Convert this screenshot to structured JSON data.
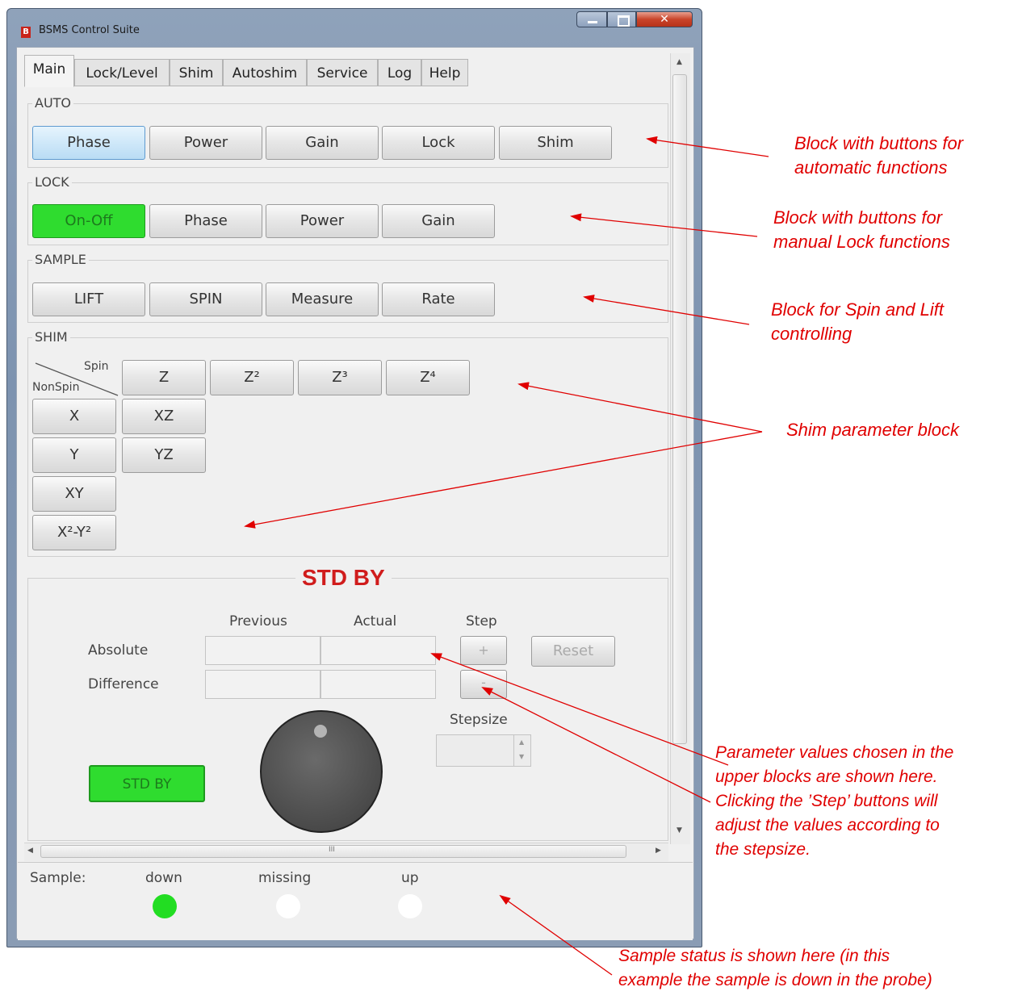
{
  "window": {
    "title": "BSMS Control Suite",
    "icon_letter": "B"
  },
  "tabs": [
    "Main",
    "Lock/Level",
    "Shim",
    "Autoshim",
    "Service",
    "Log",
    "Help"
  ],
  "auto": {
    "label": "AUTO",
    "buttons": [
      "Phase",
      "Power",
      "Gain",
      "Lock",
      "Shim"
    ]
  },
  "lock": {
    "label": "LOCK",
    "buttons": [
      "On-Off",
      "Phase",
      "Power",
      "Gain"
    ]
  },
  "sample_group": {
    "label": "SAMPLE",
    "buttons": [
      "LIFT",
      "SPIN",
      "Measure",
      "Rate"
    ]
  },
  "shim": {
    "label": "SHIM",
    "spin_label": "Spin",
    "nonspin_label": "NonSpin",
    "spin_buttons": [
      "Z",
      "Z²",
      "Z³",
      "Z⁴"
    ],
    "nonspin_buttons": [
      "X",
      "XZ",
      "Y",
      "YZ",
      "XY",
      "X²-Y²"
    ]
  },
  "control": {
    "status": "STD BY",
    "col_previous": "Previous",
    "col_actual": "Actual",
    "col_step": "Step",
    "row_absolute": "Absolute",
    "row_difference": "Difference",
    "plus": "+",
    "minus": "-",
    "reset": "Reset",
    "stepsize": "Stepsize",
    "stdby_button": "STD BY",
    "scroll_grip": "III"
  },
  "sample_status": {
    "label": "Sample:",
    "down": "down",
    "missing": "missing",
    "up": "up"
  },
  "colors": {
    "active_green": "#22dd22",
    "status_red": "#d01c1c",
    "annotation_red": "#e00000"
  },
  "annotations": {
    "auto": [
      "Block with buttons for",
      "automatic functions"
    ],
    "lock": [
      "Block with buttons for",
      "manual Lock functions"
    ],
    "spin": [
      "Block for Spin and Lift",
      "controlling"
    ],
    "shim": "Shim parameter block",
    "params": [
      "Parameter values chosen in the",
      "upper blocks are shown here.",
      "Clicking the ’Step’ buttons will",
      "adjust the values according to",
      "the stepsize."
    ],
    "sample": [
      "Sample status is shown here (in this",
      "example the sample is down in the probe)"
    ]
  }
}
